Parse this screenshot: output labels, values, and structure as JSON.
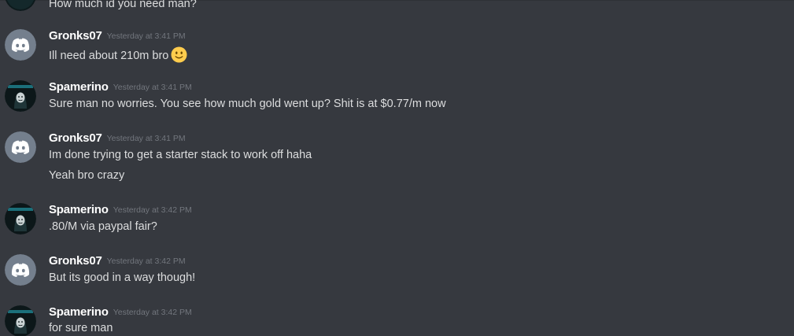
{
  "chat": {
    "cut_message": {
      "avatar_icon": "spamerino-avatar",
      "text": "How much id you need man?"
    },
    "messages": [
      {
        "username": "Gronks07",
        "timestamp": "Yesterday at 3:41 PM",
        "avatar_icon": "discord-default-avatar",
        "lines": [
          "Ill need about 210m bro"
        ],
        "emoji": "slight-smile-emoji"
      },
      {
        "username": "Spamerino",
        "timestamp": "Yesterday at 3:41 PM",
        "avatar_icon": "spamerino-avatar",
        "lines": [
          "Sure man no worries. You see how much gold went up? Shit is at $0.77/m now"
        ]
      },
      {
        "username": "Gronks07",
        "timestamp": "Yesterday at 3:41 PM",
        "avatar_icon": "discord-default-avatar",
        "lines": [
          "Im done trying to get a starter stack to work off haha",
          "Yeah bro crazy"
        ]
      },
      {
        "username": "Spamerino",
        "timestamp": "Yesterday at 3:42 PM",
        "avatar_icon": "spamerino-avatar",
        "lines": [
          ".80/M via paypal fair?"
        ]
      },
      {
        "username": "Gronks07",
        "timestamp": "Yesterday at 3:42 PM",
        "avatar_icon": "discord-default-avatar",
        "lines": [
          "But its good in a way though!"
        ]
      },
      {
        "username": "Spamerino",
        "timestamp": "Yesterday at 3:42 PM",
        "avatar_icon": "spamerino-avatar",
        "lines": [
          "for sure man"
        ]
      }
    ]
  },
  "colors": {
    "background": "#36393f",
    "username": "#ffffff",
    "timestamp": "#72767d",
    "message_text": "#dcddde",
    "default_avatar": "#747f8d"
  }
}
